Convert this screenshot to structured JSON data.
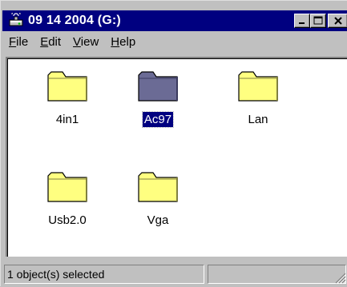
{
  "window": {
    "title": "09 14 2004 (G:)",
    "title_icon": "drive-icon",
    "controls": [
      "minimize-icon",
      "maximize-icon",
      "close-icon"
    ]
  },
  "menu": [
    {
      "accel": "F",
      "rest": "ile"
    },
    {
      "accel": "E",
      "rest": "dit"
    },
    {
      "accel": "V",
      "rest": "iew"
    },
    {
      "accel": "H",
      "rest": "elp"
    }
  ],
  "items": [
    {
      "label": "4in1",
      "icon": "folder-icon",
      "selected": false
    },
    {
      "label": "Ac97",
      "icon": "folder-icon",
      "selected": true
    },
    {
      "label": "Lan",
      "icon": "folder-icon",
      "selected": false
    },
    {
      "label": "Usb2.0",
      "icon": "folder-icon",
      "selected": false
    },
    {
      "label": "Vga",
      "icon": "folder-icon",
      "selected": false
    }
  ],
  "status": {
    "selection_text": "1 object(s) selected"
  },
  "colors": {
    "titlebar": "#000080",
    "folder": "#ffff80",
    "folder_selected": "#6b6b95",
    "selection": "#000080"
  }
}
